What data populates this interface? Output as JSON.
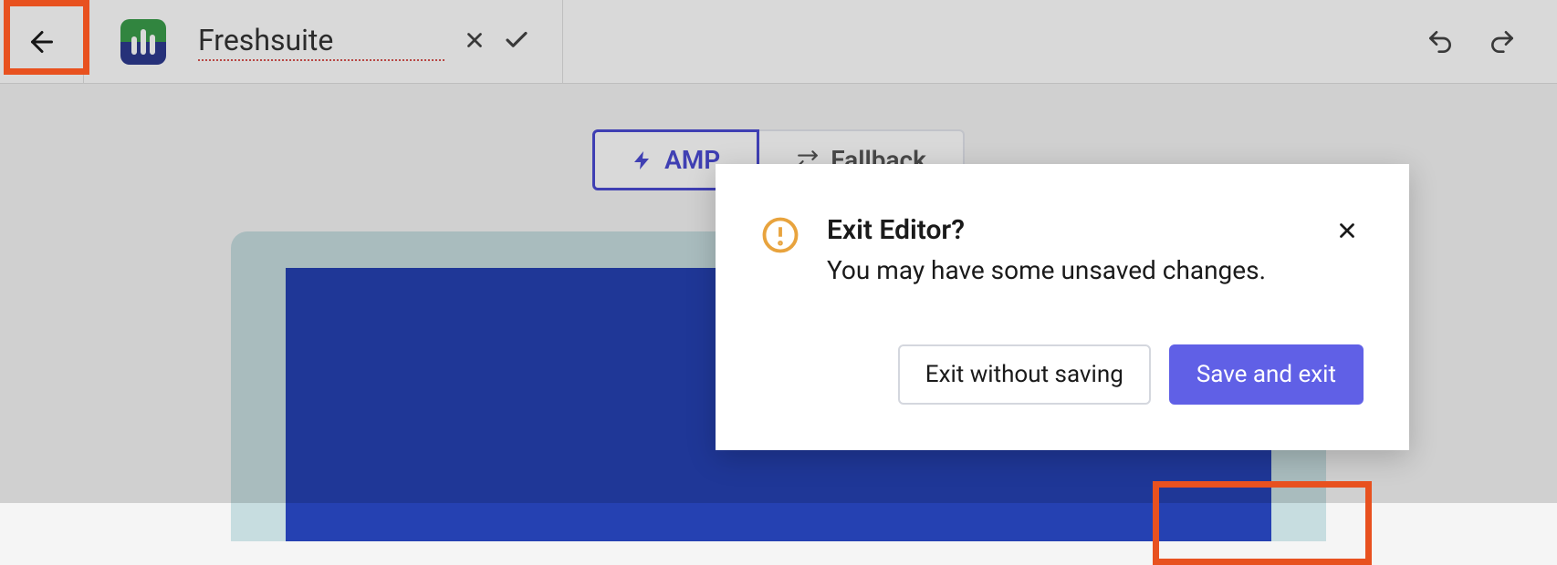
{
  "toolbar": {
    "title": "Freshsuite"
  },
  "tabs": {
    "amp": "AMP",
    "fallback": "Fallback"
  },
  "dialog": {
    "title": "Exit Editor?",
    "message": "You may have some unsaved changes.",
    "exit_without_saving": "Exit without saving",
    "save_and_exit": "Save and exit"
  }
}
